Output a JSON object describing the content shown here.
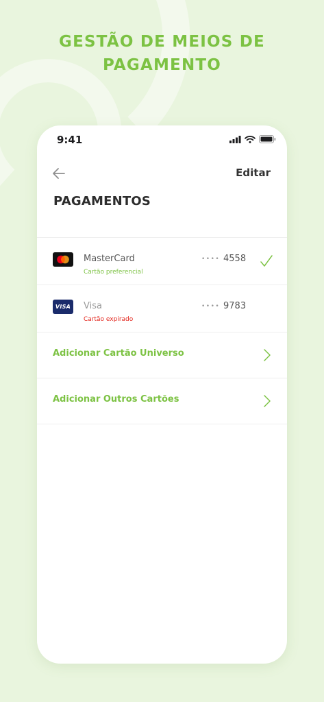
{
  "headline": {
    "line1": "GESTÃO DE MEIOS DE",
    "line2": "PAGAMENTO"
  },
  "status_bar": {
    "time": "9:41",
    "icons": [
      "signal-icon",
      "wifi-icon",
      "battery-icon"
    ]
  },
  "header": {
    "back_icon": "arrow-left-icon",
    "edit_label": "Editar",
    "title": "PAGAMENTOS"
  },
  "cards": [
    {
      "brand": "MasterCard",
      "logo": "mastercard-logo",
      "masked": "••••",
      "last4": "4558",
      "status": "Cartão preferencial",
      "status_color": "#7cc243",
      "selected": true
    },
    {
      "brand": "Visa",
      "logo": "visa-logo",
      "logo_text": "VISA",
      "masked": "••••",
      "last4": "9783",
      "status": "Cartão expirado",
      "status_color": "#e3261d",
      "selected": false
    }
  ],
  "actions": [
    {
      "label": "Adicionar Cartão Universo",
      "icon": "chevron-right-icon"
    },
    {
      "label": "Adicionar Outros Cartões",
      "icon": "chevron-right-icon"
    }
  ],
  "colors": {
    "accent": "#7cc243",
    "background": "#e9f5de",
    "error": "#e3261d"
  }
}
